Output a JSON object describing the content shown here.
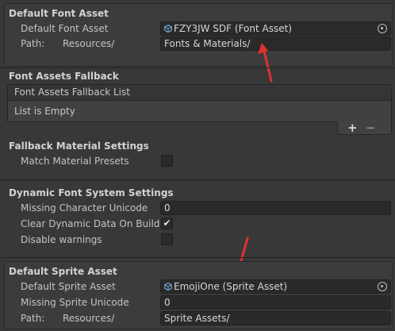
{
  "default_font_asset": {
    "header": "Default Font Asset",
    "asset_label": "Default Font Asset",
    "asset_value": "FZY3JW SDF (Font Asset)",
    "path_label": "Path:",
    "path_prefix": "Resources/",
    "path_value": "Fonts & Materials/"
  },
  "fallback": {
    "header": "Font Assets Fallback",
    "list_header": "Font Assets Fallback List",
    "list_empty": "List is Empty",
    "add_label": "+",
    "remove_label": "−"
  },
  "fallback_material": {
    "header": "Fallback Material Settings",
    "match_label": "Match Material Presets",
    "match_checked": false
  },
  "dynamic_font": {
    "header": "Dynamic Font System Settings",
    "missing_unicode_label": "Missing Character Unicode",
    "missing_unicode_value": "0",
    "clear_label": "Clear Dynamic Data On Build",
    "clear_check": "✔",
    "disable_warnings_label": "Disable warnings"
  },
  "default_sprite": {
    "header": "Default Sprite Asset",
    "asset_label": "Default Sprite Asset",
    "asset_value": "EmojiOne (Sprite Asset)",
    "missing_unicode_label": "Missing Sprite Unicode",
    "missing_unicode_value": "0",
    "path_label": "Path:",
    "path_prefix": "Resources/",
    "path_value": "Sprite Assets/"
  },
  "colors": {
    "background": "#383838",
    "field": "#2a2a2a",
    "annotation_arrow": "#e03030"
  }
}
